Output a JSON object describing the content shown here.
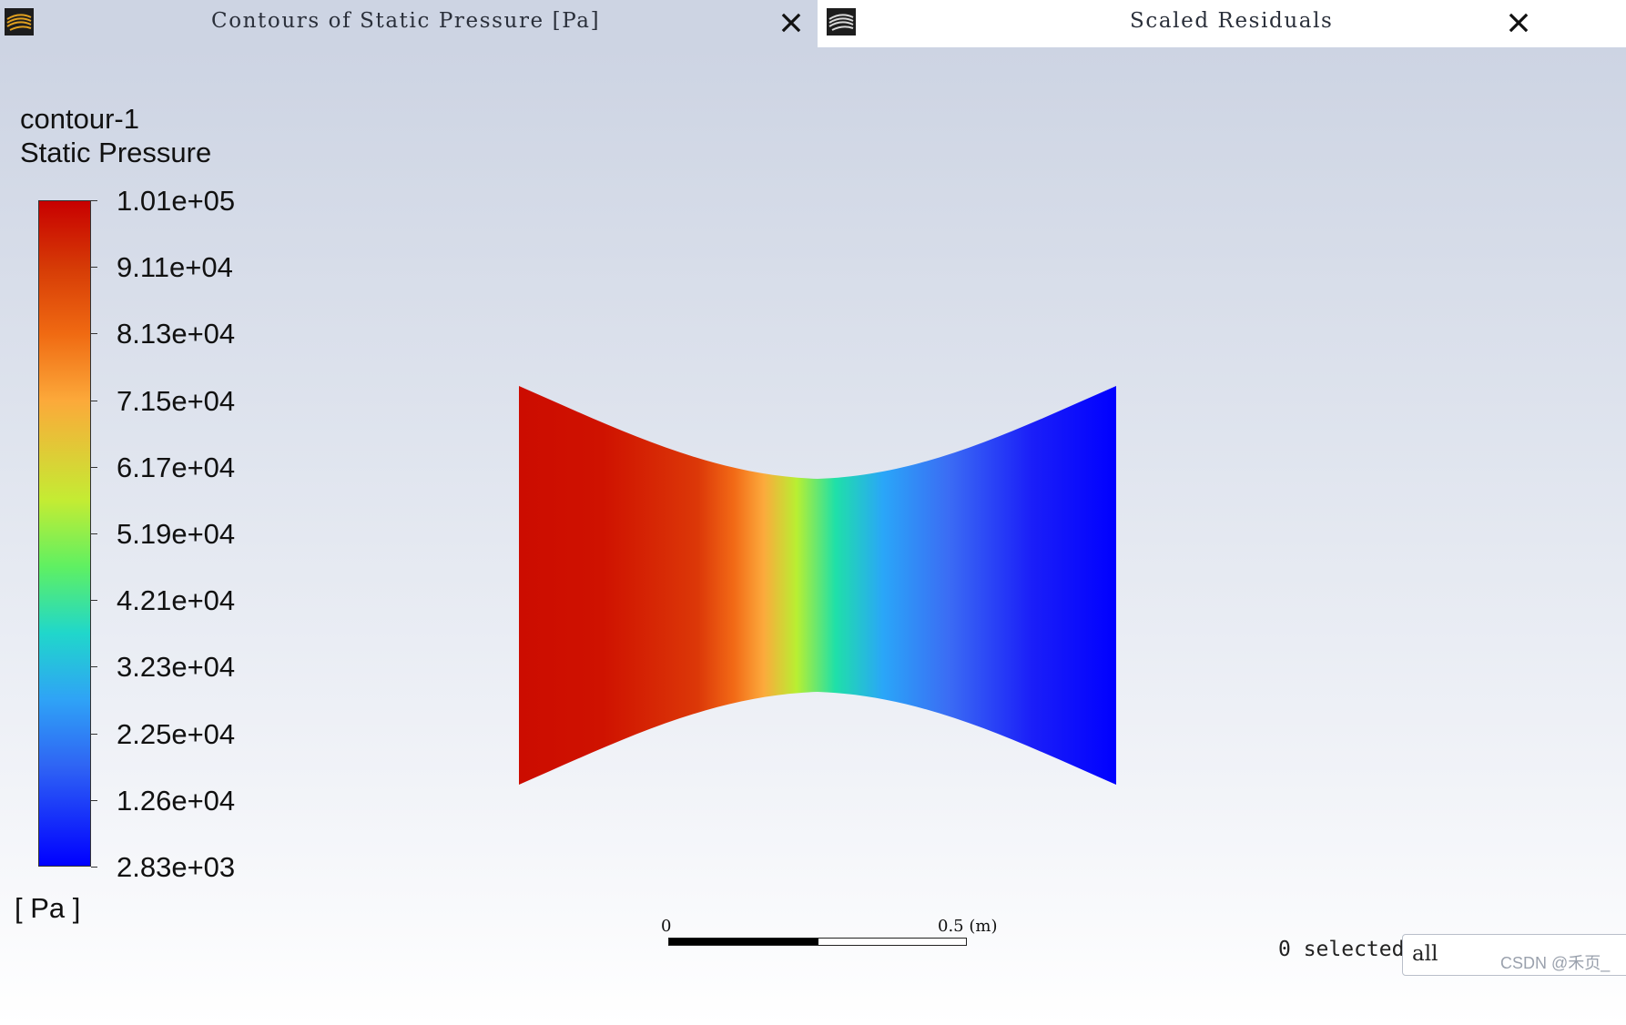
{
  "tabs": [
    {
      "title": "Contours of Static Pressure [Pa]",
      "icon": "fluent-app-icon",
      "active": true
    },
    {
      "title": "Scaled Residuals",
      "icon": "fluent-app-icon",
      "active": false
    }
  ],
  "legend": {
    "name": "contour-1",
    "quantity": "Static Pressure",
    "units": "[ Pa ]",
    "levels": [
      "1.01e+05",
      "9.11e+04",
      "8.13e+04",
      "7.15e+04",
      "6.17e+04",
      "5.19e+04",
      "4.21e+04",
      "3.23e+04",
      "2.25e+04",
      "1.26e+04",
      "2.83e+03"
    ]
  },
  "scale_bar": {
    "start_label": "0",
    "end_label": "0.5 (m)"
  },
  "selection": {
    "count_text": "0 selected",
    "filter_value": "all"
  },
  "watermark": "CSDN @禾页_",
  "colors": {
    "high": "#c80000",
    "mid": "#c4ec33",
    "low": "#0000ff",
    "tab_active_bg": "#cdd4e3",
    "tab_inactive_bg": "#ffffff"
  }
}
